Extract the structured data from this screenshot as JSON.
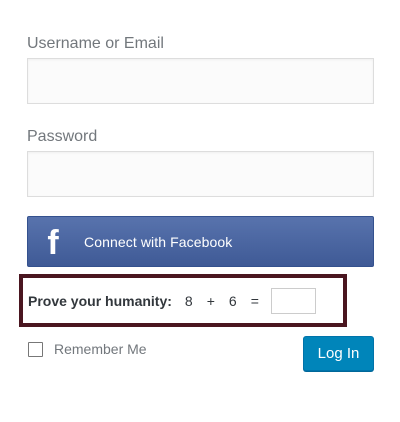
{
  "form": {
    "username_label": "Username or Email",
    "username_value": "",
    "password_label": "Password",
    "password_value": ""
  },
  "facebook": {
    "icon": "facebook-f-icon",
    "icon_glyph": "f",
    "label": "Connect with Facebook",
    "color": "#3f5a96"
  },
  "captcha": {
    "prompt": "Prove your humanity:",
    "operand_a": "8",
    "operator": "+",
    "operand_b": "6",
    "equals": "=",
    "answer_value": "",
    "highlight_color": "#4a1620"
  },
  "remember": {
    "label": "Remember Me",
    "checked": false
  },
  "submit": {
    "label": "Log In",
    "color": "#0085ba"
  }
}
